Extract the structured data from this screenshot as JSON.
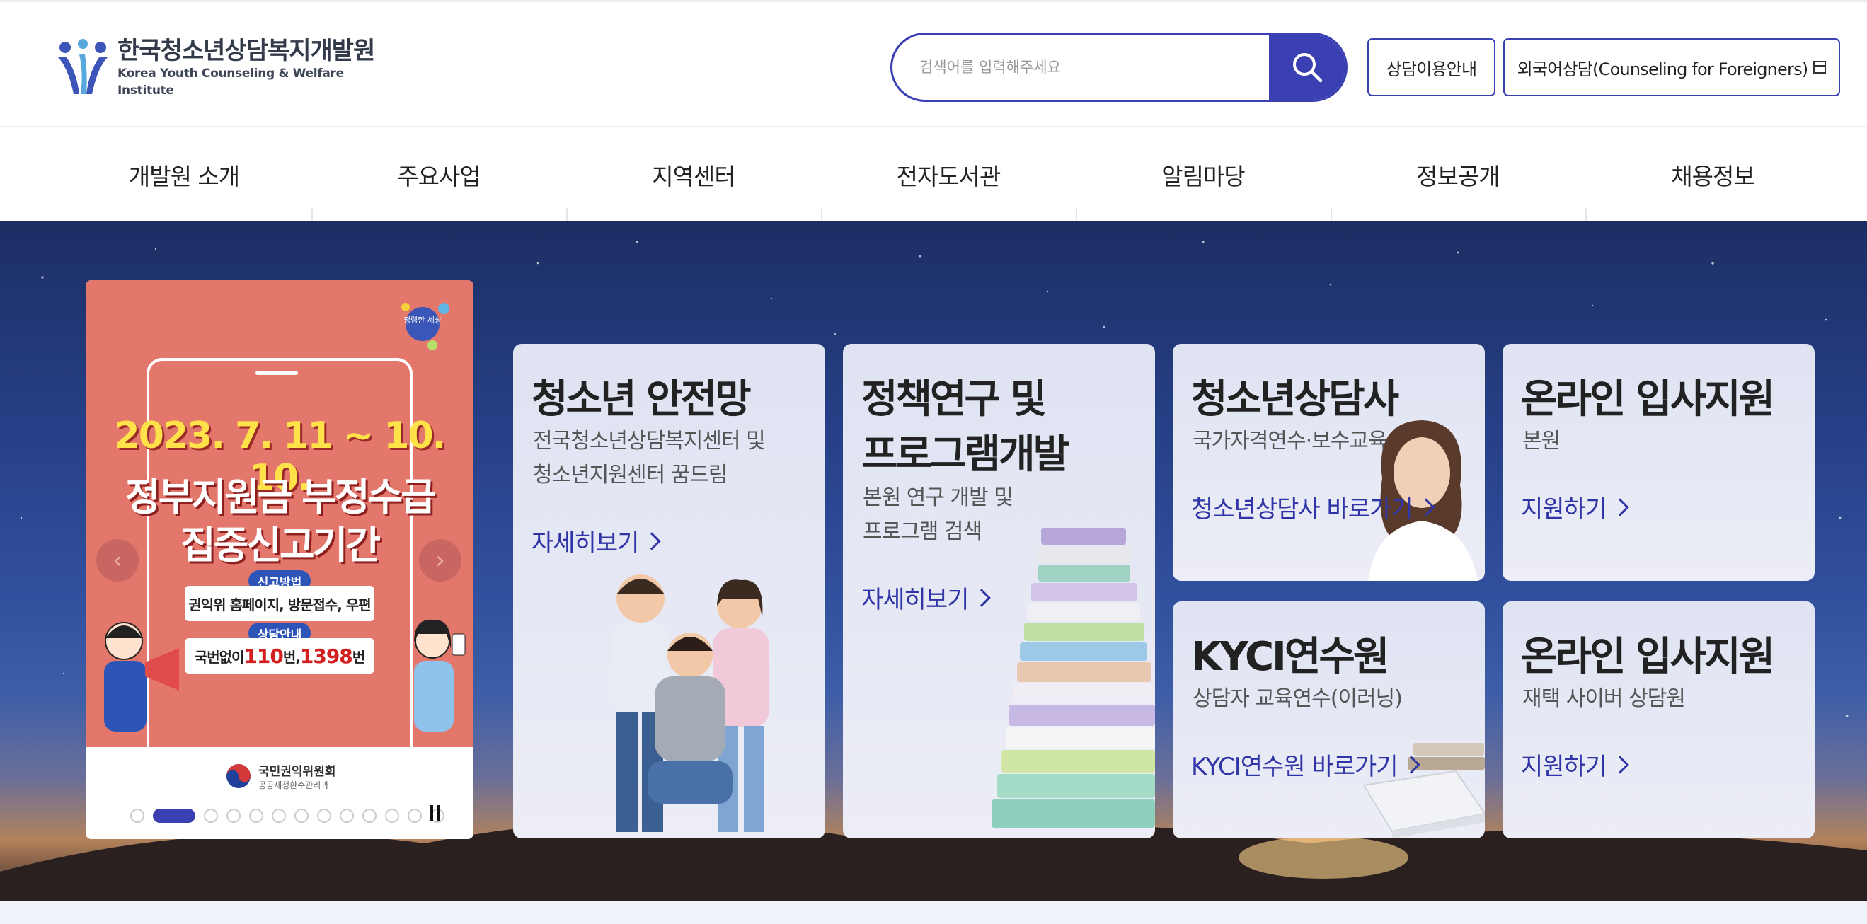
{
  "header": {
    "logo_ko": "한국청소년상담복지개발원",
    "logo_en": "Korea Youth Counseling & Welfare Institute",
    "search_placeholder": "검색어를 입력해주세요",
    "guide_button": "상담이용안내",
    "foreign_button": "외국어상담(Counseling for Foreigners)"
  },
  "gnb": {
    "items": [
      "개발원 소개",
      "주요사업",
      "지역센터",
      "전자도서관",
      "알림마당",
      "정보공개",
      "채용정보"
    ]
  },
  "banner": {
    "date": "2023. 7. 11 ~ 10. 10.",
    "title_line1": "정부지원금 부정수급",
    "title_line2": "집중신고기간",
    "pill1": "신고방법",
    "box1": "권익위 홈페이지, 방문접수, 우편",
    "pill2": "상담안내",
    "box2_pre": "국번없이 ",
    "box2_n1": "110",
    "box2_mid": "번, ",
    "box2_n2": "1398",
    "box2_post": "번",
    "badge": "청렴한 세상",
    "org_name": "국민권익위원회",
    "org_sub": "공공재정환수관리과",
    "prev_arrow": "‹",
    "next_arrow": "›",
    "dot_count": 13,
    "active_dot": 1
  },
  "cards": [
    {
      "title": "청소년 안전망",
      "desc1": "전국청소년상담복지센터 및",
      "desc2": "청소년지원센터 꿈드림",
      "link": "자세히보기"
    },
    {
      "title1": "정책연구 및",
      "title2": "프로그램개발",
      "desc1": "본원 연구 개발 및",
      "desc2": "프로그램 검색",
      "link": "자세히보기"
    },
    {
      "title": "청소년상담사",
      "desc1": "국가자격연수·보수교육",
      "link": "청소년상담사 바로가기"
    },
    {
      "title": "온라인 입사지원",
      "desc1": "본원",
      "link": "지원하기"
    },
    {
      "title": "KYCI연수원",
      "desc1": "상담자 교육연수(이러닝)",
      "link": "KYCI연수원 바로가기"
    },
    {
      "title": "온라인 입사지원",
      "desc1": "재택 사이버 상담원",
      "link": "지원하기"
    }
  ],
  "colors": {
    "primary": "#3a3fb2",
    "link": "#2f35a6",
    "banner_bg": "#e3776b",
    "banner_date": "#ffe14a"
  }
}
